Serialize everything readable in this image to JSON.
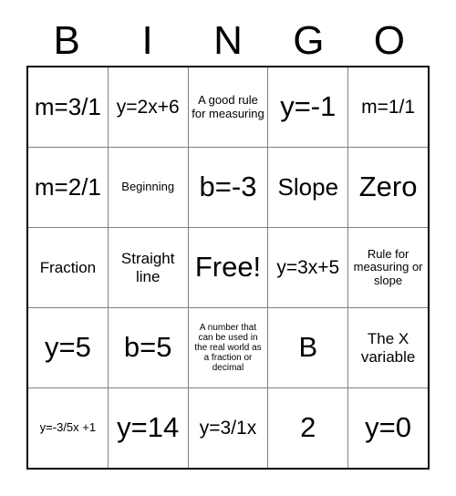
{
  "card": {
    "header_letters": [
      "B",
      "I",
      "N",
      "G",
      "O"
    ],
    "free_space_label": "Free!",
    "rows": [
      [
        {
          "text": "m=3/1",
          "size": "lg"
        },
        {
          "text": "y=2x+6",
          "size": "md"
        },
        {
          "text": "A good rule for measuring",
          "size": "xs"
        },
        {
          "text": "y=-1",
          "size": "xl"
        },
        {
          "text": "m=1/1",
          "size": "md"
        }
      ],
      [
        {
          "text": "m=2/1",
          "size": "lg"
        },
        {
          "text": "Beginning",
          "size": "xs"
        },
        {
          "text": "b=-3",
          "size": "xl"
        },
        {
          "text": "Slope",
          "size": "lg"
        },
        {
          "text": "Zero",
          "size": "xl"
        }
      ],
      [
        {
          "text": "Fraction",
          "size": "sm"
        },
        {
          "text": "Straight line",
          "size": "sm"
        },
        {
          "text": "Free!",
          "size": "xl"
        },
        {
          "text": "y=3x+5",
          "size": "md"
        },
        {
          "text": "Rule for measuring or slope",
          "size": "xs"
        }
      ],
      [
        {
          "text": "y=5",
          "size": "xl"
        },
        {
          "text": "b=5",
          "size": "xl"
        },
        {
          "text": "A number that can be used in the real world as a fraction or decimal",
          "size": "xxs"
        },
        {
          "text": "B",
          "size": "xl"
        },
        {
          "text": "The X variable",
          "size": "sm"
        }
      ],
      [
        {
          "text": "y=-3/5x +1",
          "size": "xs"
        },
        {
          "text": "y=14",
          "size": "xl"
        },
        {
          "text": "y=3/1x",
          "size": "md"
        },
        {
          "text": "2",
          "size": "xl"
        },
        {
          "text": "y=0",
          "size": "xl"
        }
      ]
    ]
  }
}
